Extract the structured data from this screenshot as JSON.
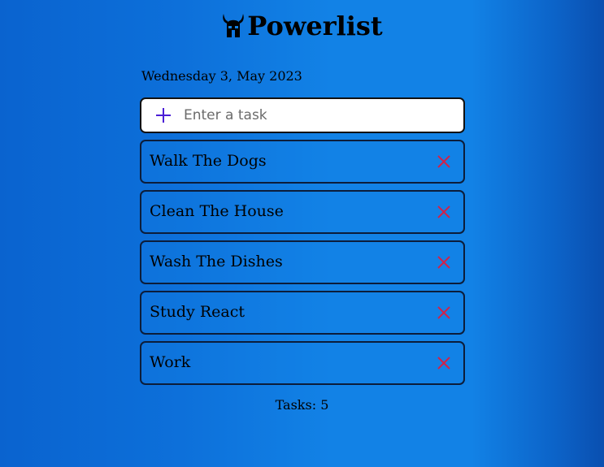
{
  "header": {
    "logo_icon": "viking-helmet-icon",
    "title": "Powerlist"
  },
  "date": "Wednesday 3, May 2023",
  "task_input": {
    "add_icon": "plus-icon",
    "placeholder": "Enter a task",
    "value": ""
  },
  "tasks": [
    {
      "label": "Walk The Dogs"
    },
    {
      "label": "Clean The House"
    },
    {
      "label": "Wash The Dishes"
    },
    {
      "label": "Study React"
    },
    {
      "label": "Work"
    }
  ],
  "footer": {
    "task_count": "Tasks: 5"
  },
  "colors": {
    "background": "#1282e6",
    "add_icon": "#4b1fd6",
    "delete_icon": "#d0224a",
    "border": "#0c1d3a"
  }
}
